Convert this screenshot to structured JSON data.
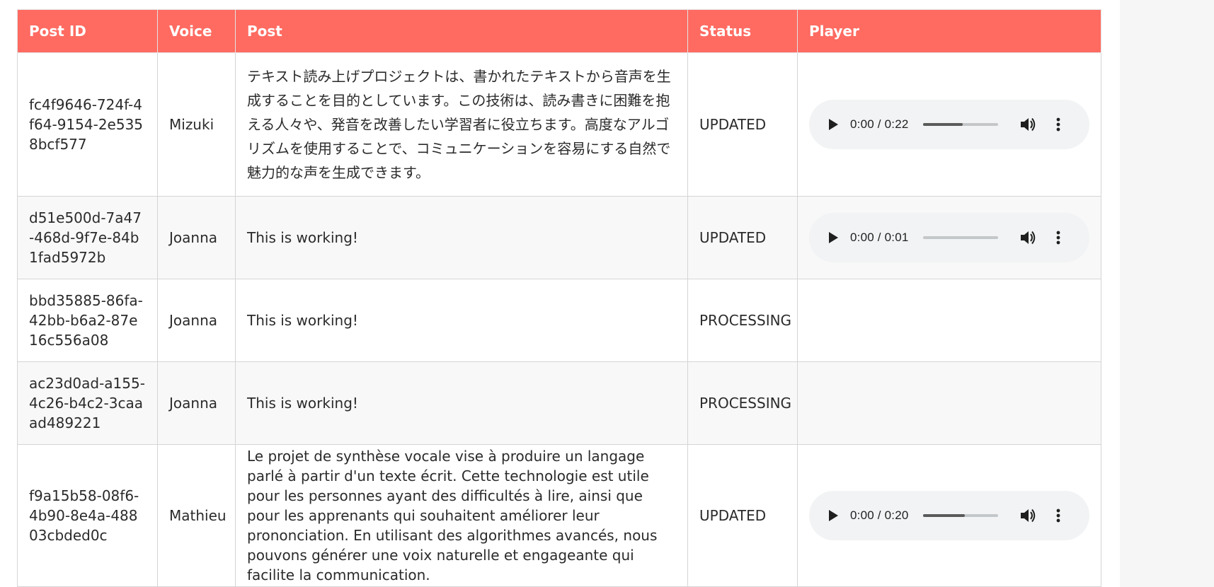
{
  "table": {
    "columns": [
      "Post ID",
      "Voice",
      "Post",
      "Status",
      "Player"
    ],
    "rows": [
      {
        "post_id": "fc4f9646-724f-4f64-9154-2e5358bcf577",
        "voice": "Mizuki",
        "post": "テキスト読み上げプロジェクトは、書かれたテキストから音声を生成することを目的としています。この技術は、読み書きに困難を抱える人々や、発音を改善したい学習者に役立ちます。高度なアルゴリズムを使用することで、コミュニケーションを容易にする自然で魅力的な声を生成できます。",
        "status": "UPDATED",
        "player": {
          "time": "0:00 / 0:22",
          "progress": 0.53
        }
      },
      {
        "post_id": "d51e500d-7a47-468d-9f7e-84b1fad5972b",
        "voice": "Joanna",
        "post": "This is working!",
        "status": "UPDATED",
        "player": {
          "time": "0:00 / 0:01",
          "progress": 0.0
        }
      },
      {
        "post_id": "bbd35885-86fa-42bb-b6a2-87e16c556a08",
        "voice": "Joanna",
        "post": "This is working!",
        "status": "PROCESSING",
        "player": null
      },
      {
        "post_id": "ac23d0ad-a155-4c26-b4c2-3caaad489221",
        "voice": "Joanna",
        "post": "This is working!",
        "status": "PROCESSING",
        "player": null
      },
      {
        "post_id": "f9a15b58-08f6-4b90-8e4a-48803cbded0c",
        "voice": "Mathieu",
        "post": "Le projet de synthèse vocale vise à produire un langage parlé à partir d'un texte écrit. Cette technologie est utile pour les personnes ayant des difficultés à lire, ainsi que pour les apprenants qui souhaitent améliorer leur prononciation. En utilisant des algorithmes avancés, nous pouvons générer une voix naturelle et engageante qui facilite la communication.",
        "status": "UPDATED",
        "player": {
          "time": "0:00 / 0:20",
          "progress": 0.56
        }
      }
    ]
  },
  "icons": {
    "play": "play-icon",
    "volume": "volume-icon",
    "more": "more-options-icon"
  },
  "colors": {
    "header_bg": "#ff6b61",
    "header_text": "#ffffff",
    "row_alt_bg": "#f8f8f8",
    "player_bg": "#f1f3f4"
  }
}
